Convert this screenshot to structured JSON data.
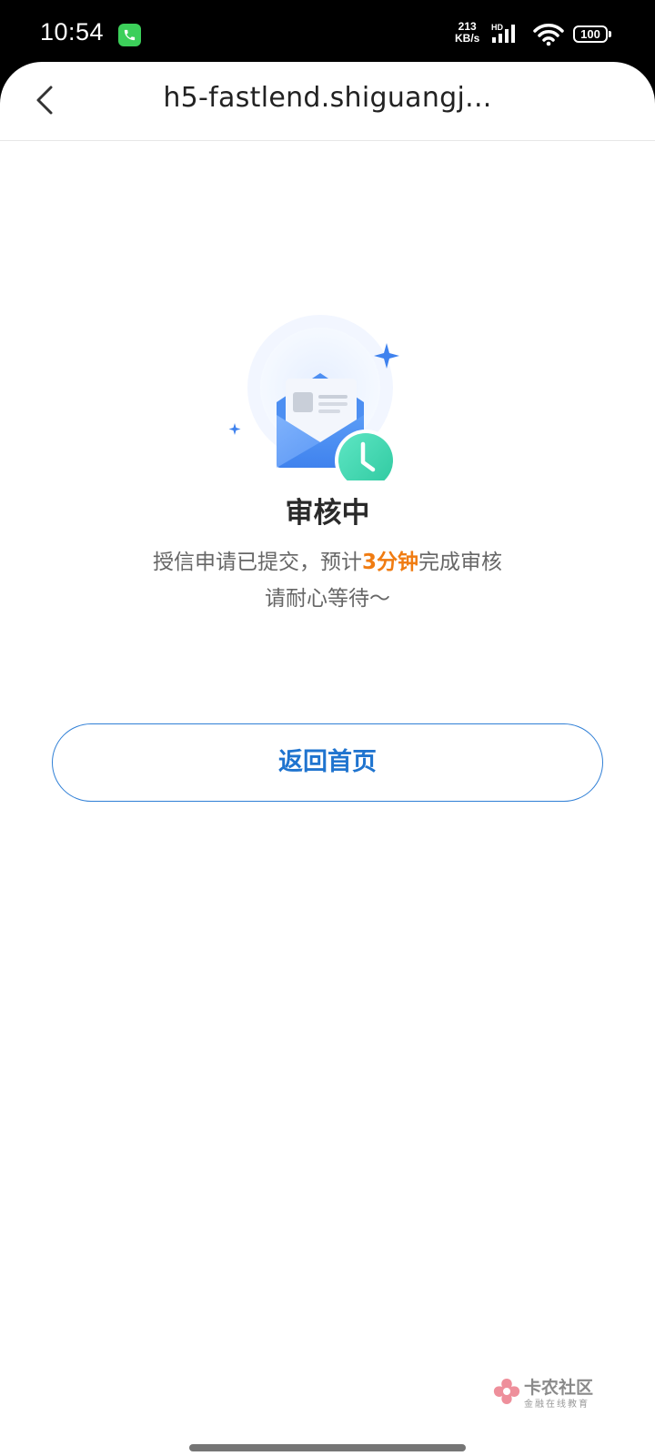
{
  "status_bar": {
    "time": "10:54",
    "net_speed_value": "213",
    "net_speed_unit": "KB/s",
    "network_type": "HD",
    "battery": "100"
  },
  "nav": {
    "title": "h5-fastlend.shiguangj..."
  },
  "main": {
    "status_title": "审核中",
    "desc_before": "授信申请已提交，预计",
    "desc_highlight": "3分钟",
    "desc_after": "完成审核",
    "desc_line2": "请耐心等待～",
    "home_button_label": "返回首页"
  },
  "watermark": {
    "main": "卡农社区",
    "sub": "金融在线教育"
  },
  "colors": {
    "accent_blue": "#1f74cf",
    "highlight_orange": "#f07c12",
    "clock_green": "#3ed6b0"
  }
}
